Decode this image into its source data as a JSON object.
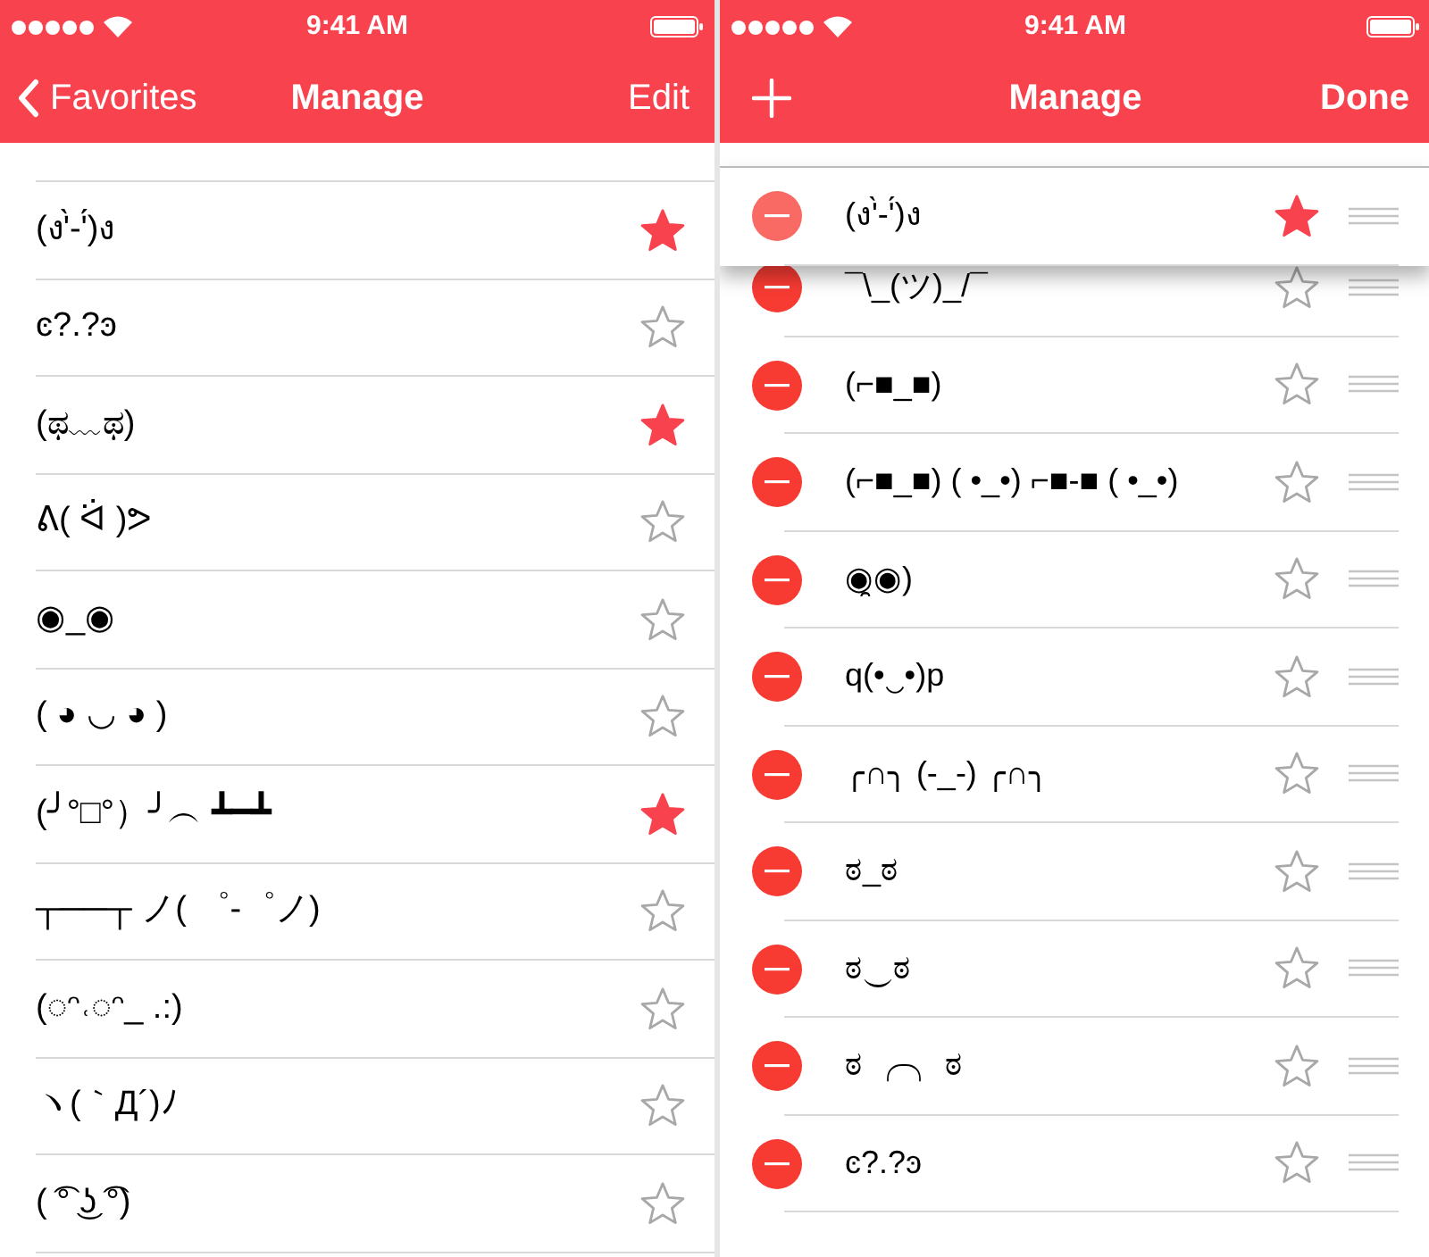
{
  "left": {
    "status_bar": {
      "time": "9:41 AM"
    },
    "nav": {
      "back": "Favorites",
      "title": "Manage",
      "action": "Edit"
    },
    "rows": [
      {
        "text": "(ง'̀-'́)ง",
        "favorite": true
      },
      {
        "text": "ͼ?.?ͽ",
        "favorite": false
      },
      {
        "text": "(ಥ﹏ಥ)",
        "favorite": true
      },
      {
        "text": "ᕕ( ᐛ )ᕗ",
        "favorite": false
      },
      {
        "text": "◉_◉",
        "favorite": false
      },
      {
        "text": "( ◕ ◡ ◕ )",
        "favorite": false
      },
      {
        "text": "(╯°□°）╯︵ ┻━┻",
        "favorite": true
      },
      {
        "text": "┬──┬ ノ( ゜-゜ノ)",
        "favorite": false
      },
      {
        "text": "(◌ᵔ˓◌ᵔ_ .:)",
        "favorite": false
      },
      {
        "text": "ヽ(｀Д´)ﾉ",
        "favorite": false
      },
      {
        "text": "( ͡° ͜ʖ ͡°)",
        "favorite": false
      }
    ]
  },
  "right": {
    "status_bar": {
      "time": "9:41 AM"
    },
    "nav": {
      "title": "Manage",
      "action": "Done"
    },
    "dragged_row": {
      "text": "(ง'̀-'́)ง",
      "favorite": true
    },
    "rows": [
      {
        "text": "¯\\_(ツ)_/¯",
        "favorite": false
      },
      {
        "text": "(⌐■_■)",
        "favorite": false
      },
      {
        "text": "(⌐■_■) ( •_•) ⌐■-■ ( •_•)",
        "favorite": false
      },
      {
        "text": "◉̯◉)",
        "favorite": false
      },
      {
        "text": "q(•‿•)p",
        "favorite": false
      },
      {
        "text": "╭∩╮ (-_-) ╭∩╮",
        "favorite": false
      },
      {
        "text": "ಠ_ಠ",
        "favorite": false
      },
      {
        "text": "ಠ‿ಠ",
        "favorite": false
      },
      {
        "text": "ಠ ╭╮ ಠ",
        "favorite": false
      },
      {
        "text": "ͼ?.?ͽ",
        "favorite": false
      }
    ]
  }
}
